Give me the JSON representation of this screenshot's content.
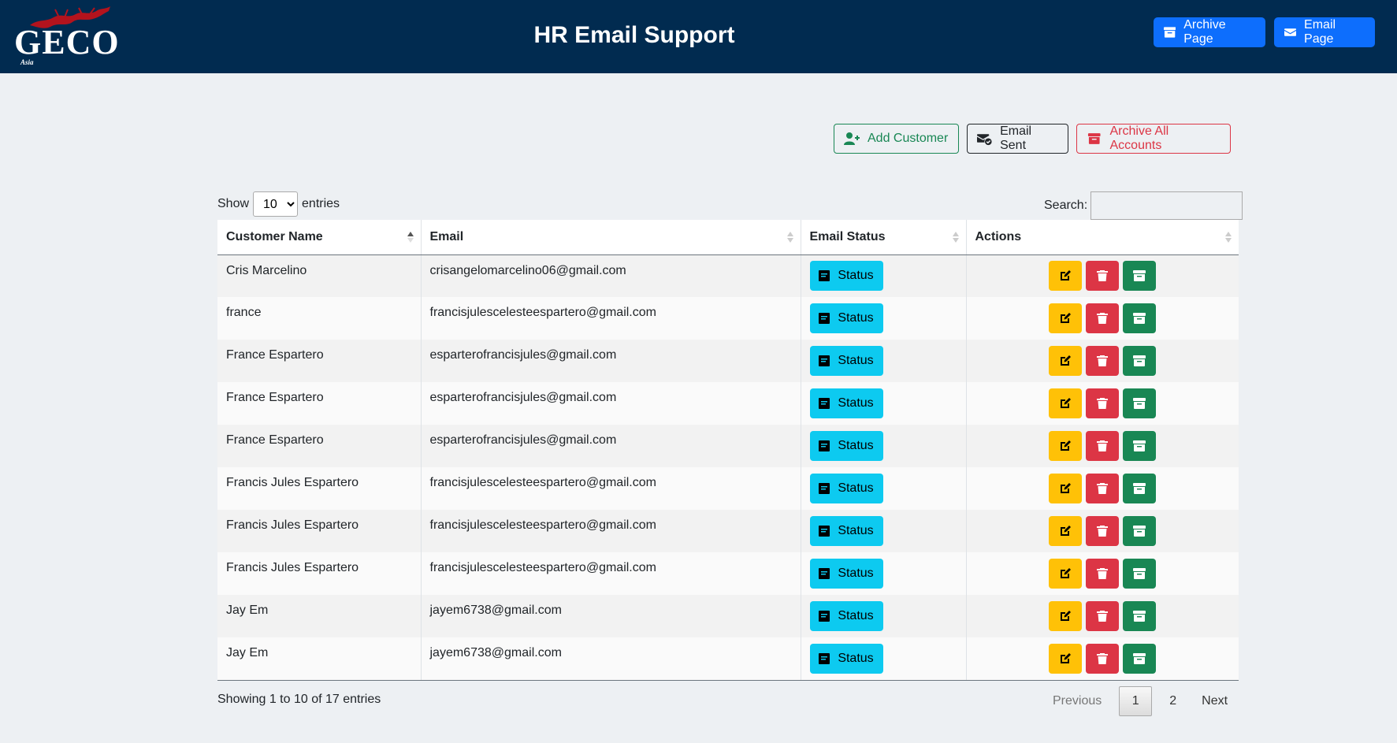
{
  "header": {
    "logo_text": "GECO",
    "logo_sub": "Asia",
    "title": "HR Email Support",
    "buttons": [
      {
        "label": "Archive Page",
        "icon": "archive-icon"
      },
      {
        "label": "Email Page",
        "icon": "envelope-icon"
      }
    ]
  },
  "toolbar": {
    "add_customer": "Add Customer",
    "email_sent": "Email Sent",
    "archive_all": "Archive All Accounts"
  },
  "length_menu": {
    "show": "Show",
    "value": "10",
    "entries": "entries"
  },
  "search": {
    "label": "Search:",
    "value": ""
  },
  "table": {
    "columns": [
      "Customer Name",
      "Email",
      "Email Status",
      "Actions"
    ],
    "status_label": "Status",
    "rows": [
      {
        "name": "Cris Marcelino",
        "email": "crisangelomarcelino06@gmail.com"
      },
      {
        "name": "france",
        "email": "francisjulescelesteespartero@gmail.com"
      },
      {
        "name": "France Espartero",
        "email": "esparterofrancisjules@gmail.com"
      },
      {
        "name": "France Espartero",
        "email": "esparterofrancisjules@gmail.com"
      },
      {
        "name": "France Espartero",
        "email": "esparterofrancisjules@gmail.com"
      },
      {
        "name": "Francis Jules Espartero",
        "email": "francisjulescelesteespartero@gmail.com"
      },
      {
        "name": "Francis Jules Espartero",
        "email": "francisjulescelesteespartero@gmail.com"
      },
      {
        "name": "Francis Jules Espartero",
        "email": "francisjulescelesteespartero@gmail.com"
      },
      {
        "name": "Jay Em",
        "email": "jayem6738@gmail.com"
      },
      {
        "name": "Jay Em",
        "email": "jayem6738@gmail.com"
      }
    ]
  },
  "footer": {
    "info": "Showing 1 to 10 of 17 entries",
    "previous": "Previous",
    "pages": [
      "1",
      "2"
    ],
    "next": "Next"
  },
  "colors": {
    "header_bg": "#012b50",
    "primary": "#0d6efd",
    "info": "#0dcaf0",
    "warning": "#ffc107",
    "danger": "#dc3545",
    "success": "#198754"
  }
}
